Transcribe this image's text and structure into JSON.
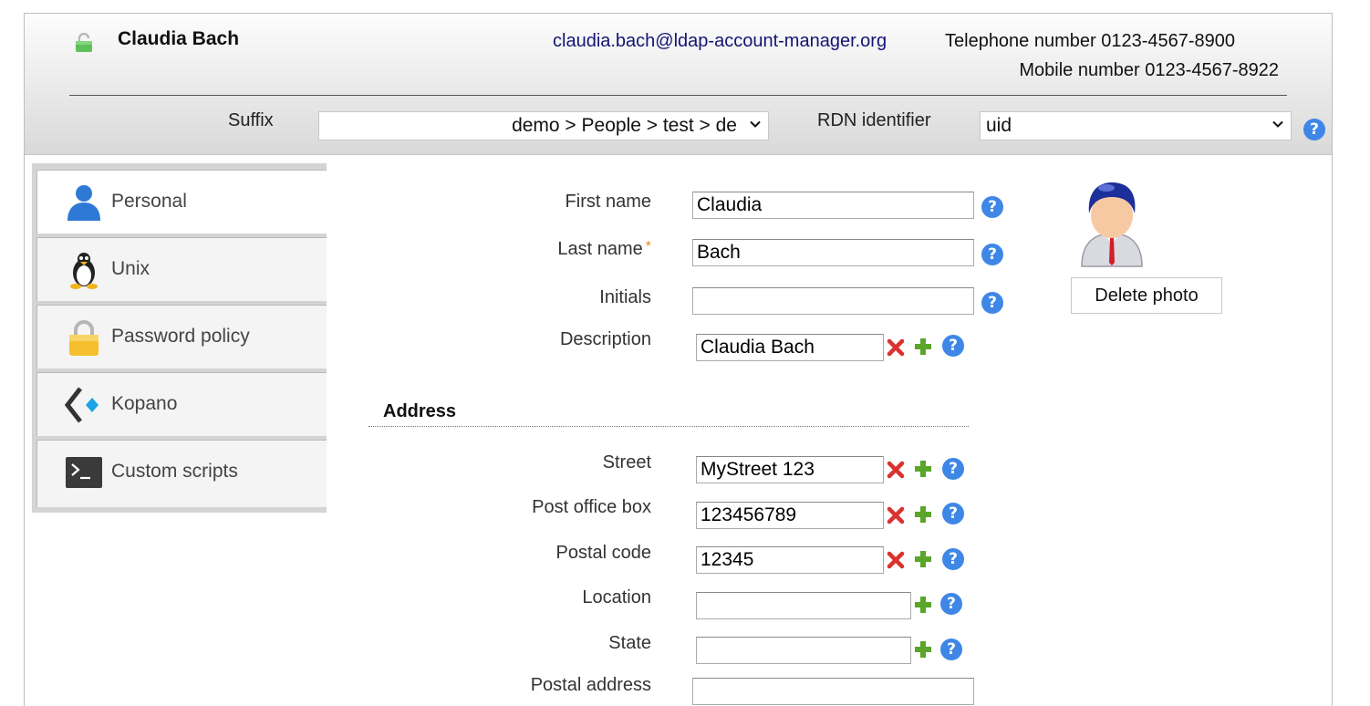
{
  "header": {
    "user_name": "Claudia Bach",
    "email": "claudia.bach@ldap-account-manager.org",
    "telephone": "Telephone number 0123-4567-8900",
    "mobile": "Mobile number 0123-4567-8922",
    "suffix_label": "Suffix",
    "suffix_value": "demo > People > test > de",
    "rdn_label": "RDN identifier",
    "rdn_value": "uid",
    "help_glyph": "?"
  },
  "sidebar": {
    "items": [
      {
        "label": "Personal",
        "icon": "person-icon",
        "active": true
      },
      {
        "label": "Unix",
        "icon": "penguin-icon"
      },
      {
        "label": "Password policy",
        "icon": "lock-icon"
      },
      {
        "label": "Kopano",
        "icon": "kopano-icon"
      },
      {
        "label": "Custom scripts",
        "icon": "terminal-icon"
      }
    ]
  },
  "form": {
    "first_name": {
      "label": "First name",
      "value": "Claudia"
    },
    "last_name": {
      "label": "Last name",
      "required_mark": "*",
      "value": "Bach"
    },
    "initials": {
      "label": "Initials",
      "value": ""
    },
    "description": {
      "label": "Description",
      "value": "Claudia Bach"
    },
    "address_title": "Address",
    "street": {
      "label": "Street",
      "value": "MyStreet 123"
    },
    "post_office_box": {
      "label": "Post office box",
      "value": "123456789"
    },
    "postal_code": {
      "label": "Postal code",
      "value": "12345"
    },
    "location": {
      "label": "Location",
      "value": ""
    },
    "state": {
      "label": "State",
      "value": ""
    },
    "postal_address": {
      "label": "Postal address",
      "value": ""
    }
  },
  "photo": {
    "delete_label": "Delete photo"
  },
  "colors": {
    "accent_help": "#3f87e6",
    "email_link": "#141474",
    "remove_red": "#d9322f",
    "add_green": "#5aa52a"
  }
}
